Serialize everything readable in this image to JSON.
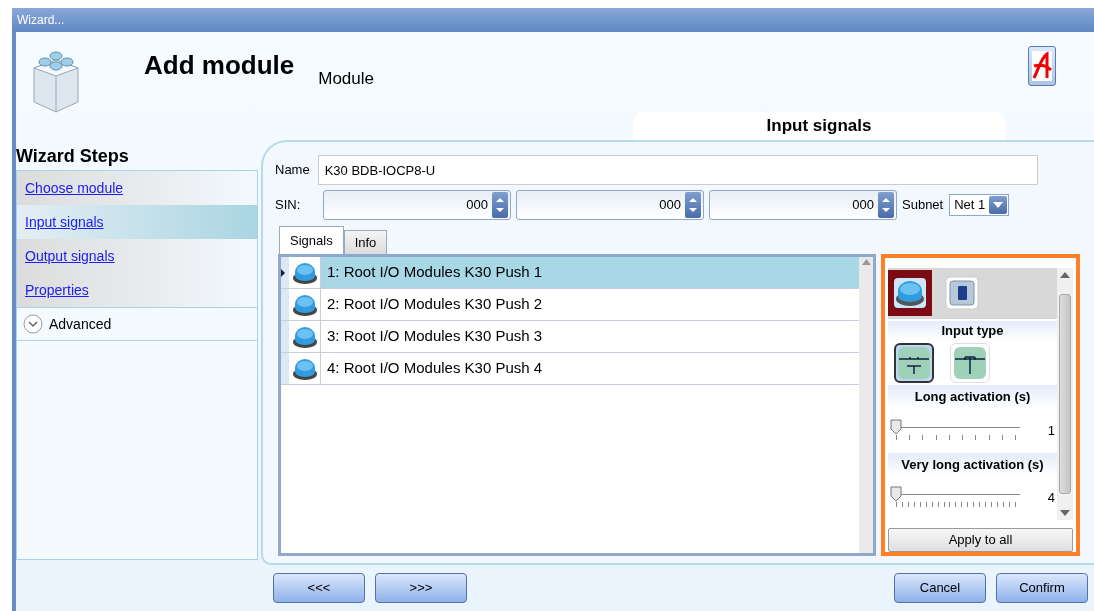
{
  "window": {
    "title": "Wizard..."
  },
  "header": {
    "title": "Add module",
    "subtitle": "Module",
    "section": "Input signals"
  },
  "wizard_steps": {
    "title": "Wizard Steps",
    "items": [
      {
        "label": "Choose module",
        "selected": false
      },
      {
        "label": "Input signals",
        "selected": true
      },
      {
        "label": "Output signals",
        "selected": false
      },
      {
        "label": "Properties",
        "selected": false
      }
    ],
    "advanced": {
      "label": "Advanced",
      "expanded": false
    }
  },
  "form": {
    "name_label": "Name",
    "name_value": "K30 BDB-IOCP8-U",
    "sin_label": "SIN:",
    "sin_values": [
      "000",
      "000",
      "000"
    ],
    "subnet_label": "Subnet",
    "subnet_value": "Net 1"
  },
  "tabs": [
    {
      "label": "Signals",
      "selected": true
    },
    {
      "label": "Info",
      "selected": false
    }
  ],
  "signals": [
    {
      "label": "1: Root I/O Modules K30 Push 1",
      "selected": true
    },
    {
      "label": "2: Root I/O Modules K30 Push 2",
      "selected": false
    },
    {
      "label": "3: Root I/O Modules K30 Push 3",
      "selected": false
    },
    {
      "label": "4: Root I/O Modules K30 Push 4",
      "selected": false
    }
  ],
  "properties": {
    "signal_types": [
      {
        "kind": "push",
        "selected": true
      },
      {
        "kind": "switch",
        "selected": false
      }
    ],
    "input_type_label": "Input type",
    "input_types": [
      {
        "kind": "normally-open",
        "selected": true
      },
      {
        "kind": "normally-closed",
        "selected": false
      }
    ],
    "sliders": [
      {
        "label": "Long activation (s)",
        "level": 0,
        "reading": "1"
      },
      {
        "label": "Very long activation (s)",
        "level": 0,
        "reading": "4"
      }
    ],
    "apply_button": "Apply to all"
  },
  "nav_buttons": [
    "<<<",
    ">>>"
  ],
  "action_buttons": [
    "Cancel",
    "Confirm"
  ]
}
